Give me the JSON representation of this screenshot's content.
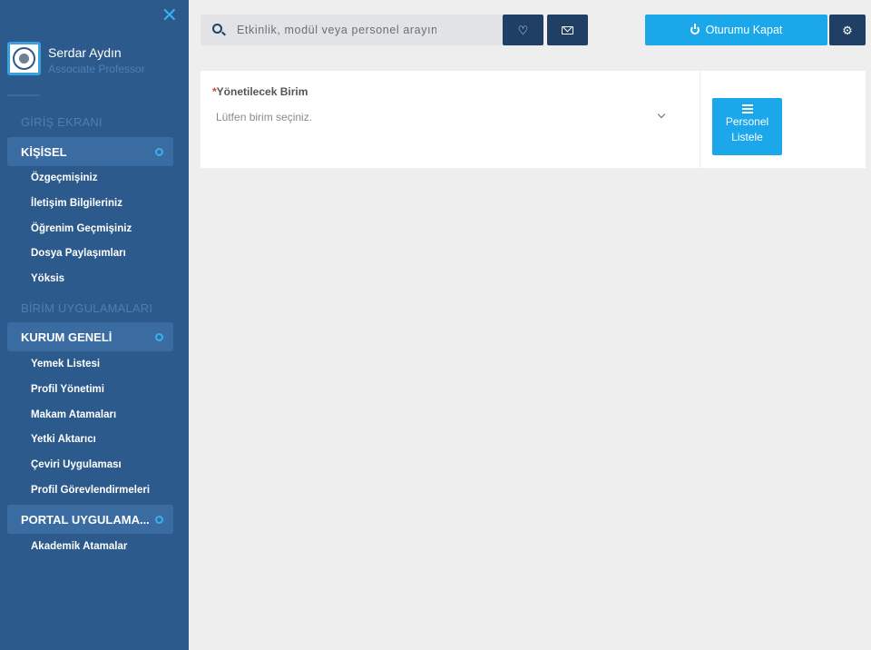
{
  "sidebar": {
    "close_icon": "close-icon",
    "user": {
      "name": "Serdar Aydın",
      "title": "Associate Professor"
    },
    "sections": [
      {
        "header": "GİRİŞ EKRANI"
      },
      {
        "header": "BİRİM UYGULAMALARI"
      }
    ],
    "groups": [
      {
        "label": "KİŞİSEL",
        "items": [
          "Özgeçmişiniz",
          "İletişim Bilgileriniz",
          "Öğrenim Geçmişiniz",
          "Dosya Paylaşımları",
          "Yöksis"
        ]
      },
      {
        "label": "KURUM GENELİ",
        "items": [
          "Yemek Listesi",
          "Profil Yönetimi",
          "Makam Atamaları",
          "Yetki Aktarıcı",
          "Çeviri Uygulaması",
          "Profil Görevlendirmeleri"
        ]
      },
      {
        "label": "PORTAL UYGULAMA...",
        "items": [
          "Akademik Atamalar"
        ]
      }
    ]
  },
  "topbar": {
    "search_placeholder": "Etkinlik, modül veya personel arayın",
    "logout_label": "Oturumu Kapat",
    "icons": {
      "search": "search-icon",
      "favorites": "heart-icon",
      "messages": "mail-icon",
      "logout": "power-icon",
      "settings": "cogs-icon"
    }
  },
  "panel": {
    "required_mark": "*",
    "field_label": "Yönetilecek Birim",
    "select_placeholder": "Lütfen birim seçiniz.",
    "list_button_line1": "Personel",
    "list_button_line2": "Listele"
  },
  "colors": {
    "sidebar_bg": "#2d5a8c",
    "accent": "#1ba8ea",
    "dark_button": "#1f3f64",
    "page_bg": "#eeeeee"
  }
}
